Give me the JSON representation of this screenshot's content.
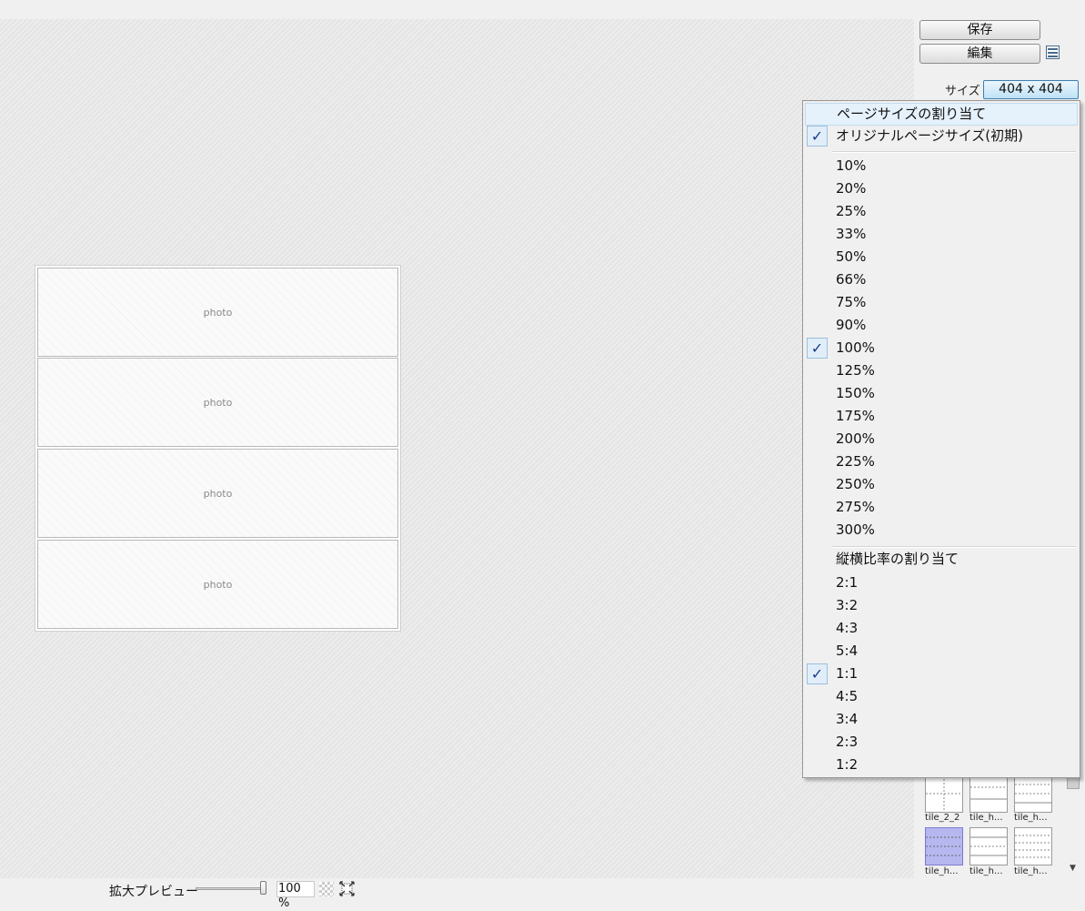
{
  "sidebar": {
    "save_label": "保存",
    "edit_label": "編集",
    "size_label": "サイズ",
    "size_value": "404 x 404",
    "thumbnails": [
      {
        "label": "tile_2_2"
      },
      {
        "label": "tile_h..."
      },
      {
        "label": "tile_h..."
      },
      {
        "label": "tile_h..."
      },
      {
        "label": "tile_h..."
      },
      {
        "label": "tile_h..."
      }
    ]
  },
  "page": {
    "photo_cells": [
      "photo",
      "photo",
      "photo",
      "photo"
    ]
  },
  "dropdown": {
    "header": "ページサイズの割り当て",
    "original": {
      "label": "オリジナルページサイズ(初期)",
      "checked": true
    },
    "zoom_options": [
      {
        "label": "10%",
        "checked": false
      },
      {
        "label": "20%",
        "checked": false
      },
      {
        "label": "25%",
        "checked": false
      },
      {
        "label": "33%",
        "checked": false
      },
      {
        "label": "50%",
        "checked": false
      },
      {
        "label": "66%",
        "checked": false
      },
      {
        "label": "75%",
        "checked": false
      },
      {
        "label": "90%",
        "checked": false
      },
      {
        "label": "100%",
        "checked": true
      },
      {
        "label": "125%",
        "checked": false
      },
      {
        "label": "150%",
        "checked": false
      },
      {
        "label": "175%",
        "checked": false
      },
      {
        "label": "200%",
        "checked": false
      },
      {
        "label": "225%",
        "checked": false
      },
      {
        "label": "250%",
        "checked": false
      },
      {
        "label": "275%",
        "checked": false
      },
      {
        "label": "300%",
        "checked": false
      }
    ],
    "aspect_header": "縦横比率の割り当て",
    "aspect_options": [
      {
        "label": "2:1",
        "checked": false
      },
      {
        "label": "3:2",
        "checked": false
      },
      {
        "label": "4:3",
        "checked": false
      },
      {
        "label": "5:4",
        "checked": false
      },
      {
        "label": "1:1",
        "checked": true
      },
      {
        "label": "4:5",
        "checked": false
      },
      {
        "label": "3:4",
        "checked": false
      },
      {
        "label": "2:3",
        "checked": false
      },
      {
        "label": "1:2",
        "checked": false
      }
    ],
    "check_glyph": "✓"
  },
  "bottombar": {
    "zoom_label": "拡大プレビュー",
    "zoom_value": "100 %",
    "zoom_fraction": 1.0
  }
}
